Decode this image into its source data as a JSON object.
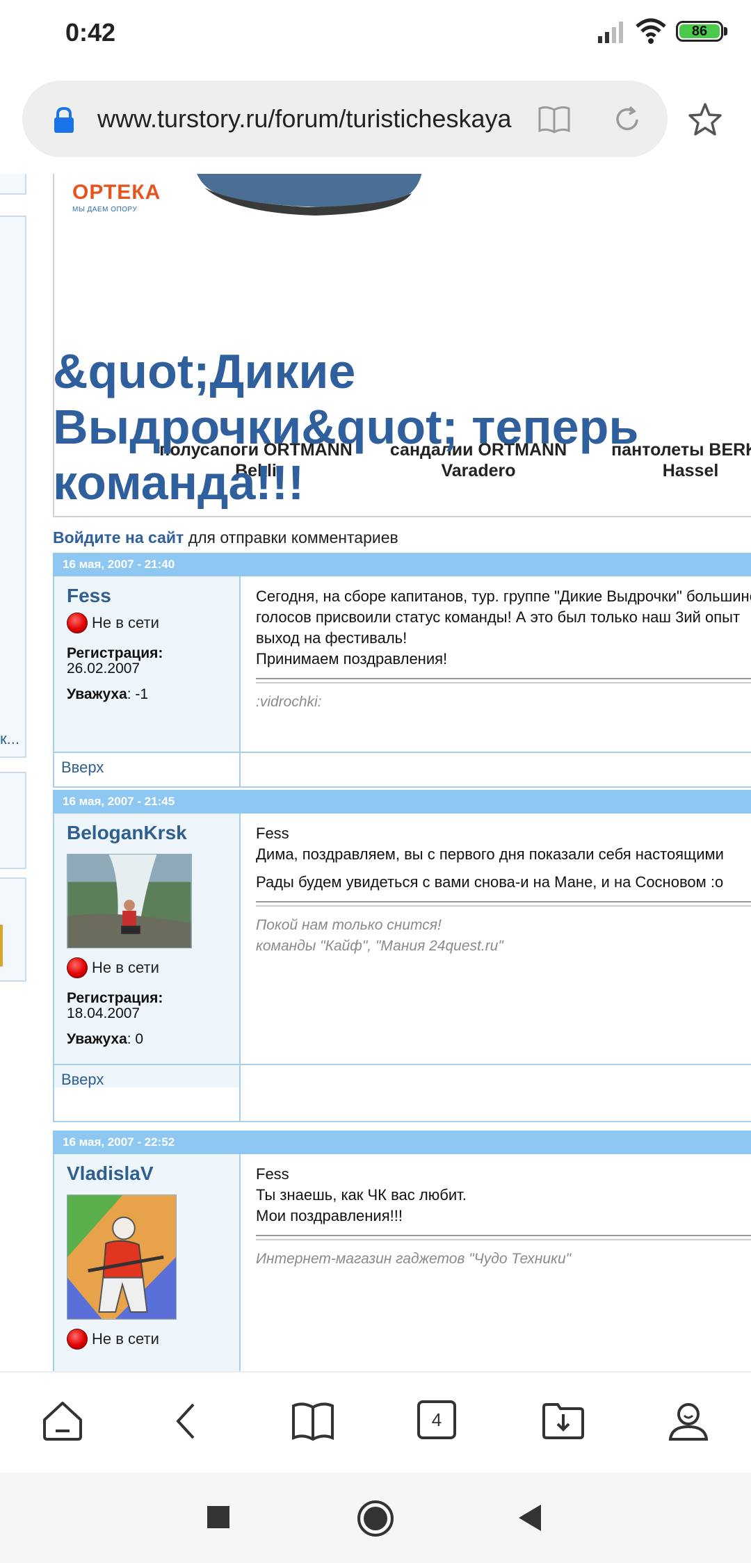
{
  "status_bar": {
    "time": "0:42",
    "battery": "86"
  },
  "address_bar": {
    "url": "www.turstory.ru/forum/turisticheskaya"
  },
  "ad": {
    "brand": "ОРТЕКА",
    "tagline": "МЫ ДАЕМ ОПОРУ",
    "products": [
      {
        "name": "полусапоги ORTMANN",
        "model": "Bekli"
      },
      {
        "name": "сандалии ORTMANN",
        "model": "Varadero"
      },
      {
        "name": "пантолеты BERKE",
        "model": "Hassel"
      }
    ]
  },
  "topic": {
    "title": "&quot;Дикие Выдрочки&quot; теперь команда!!!",
    "login_link": "Войдите на сайт",
    "login_suffix": " для отправки комментариев"
  },
  "posts": [
    {
      "date": "16 мая, 2007 - 21:40",
      "user": "Fess",
      "online": "Не в сети",
      "reg_label": "Регистрация:",
      "reg_date": "26.02.2007",
      "karma_label": "Уважуха",
      "karma": ": -1",
      "lines": [
        "Сегодня, на сборе капитанов, тур. группе \"Дикие Выдрочки\" большинством",
        "голосов присвоили статус команды! А это был только наш 3ий опыт",
        "выход на фестиваль!",
        "Принимаем поздравления!"
      ],
      "signature": [
        ":vidrochki:"
      ],
      "top_link": "Вверх"
    },
    {
      "date": "16 мая, 2007 - 21:45",
      "user": "BeloganKrsk",
      "online": "Не в сети",
      "reg_label": "Регистрация:",
      "reg_date": "18.04.2007",
      "karma_label": "Уважуха",
      "karma": ": 0",
      "quote": "Fess",
      "lines": [
        "Дима, поздравляем, вы с первого дня показали себя настоящими",
        "Рады будем увидеться с вами снова-и на Мане, и на Сосновом :о"
      ],
      "signature": [
        "Покой нам только снится!",
        "команды \"Кайф\", \"Мания 24quest.ru\""
      ],
      "top_link": "Вверх"
    },
    {
      "date": "16 мая, 2007 - 22:52",
      "user": "VladislaV",
      "online": "Не в сети",
      "quote": "Fess",
      "lines": [
        "Ты знаешь, как ЧК вас любит.",
        "Мои поздравления!!!"
      ],
      "signature": [
        "Интернет-магазин гаджетов \"Чудо Техники\""
      ]
    }
  ],
  "toolbar": {
    "tab_count": "4"
  },
  "colors": {
    "link_blue": "#2f5f9c",
    "post_header": "#8ec8f2",
    "user_bg": "#eef5fb",
    "offline_red": "#e00000"
  }
}
